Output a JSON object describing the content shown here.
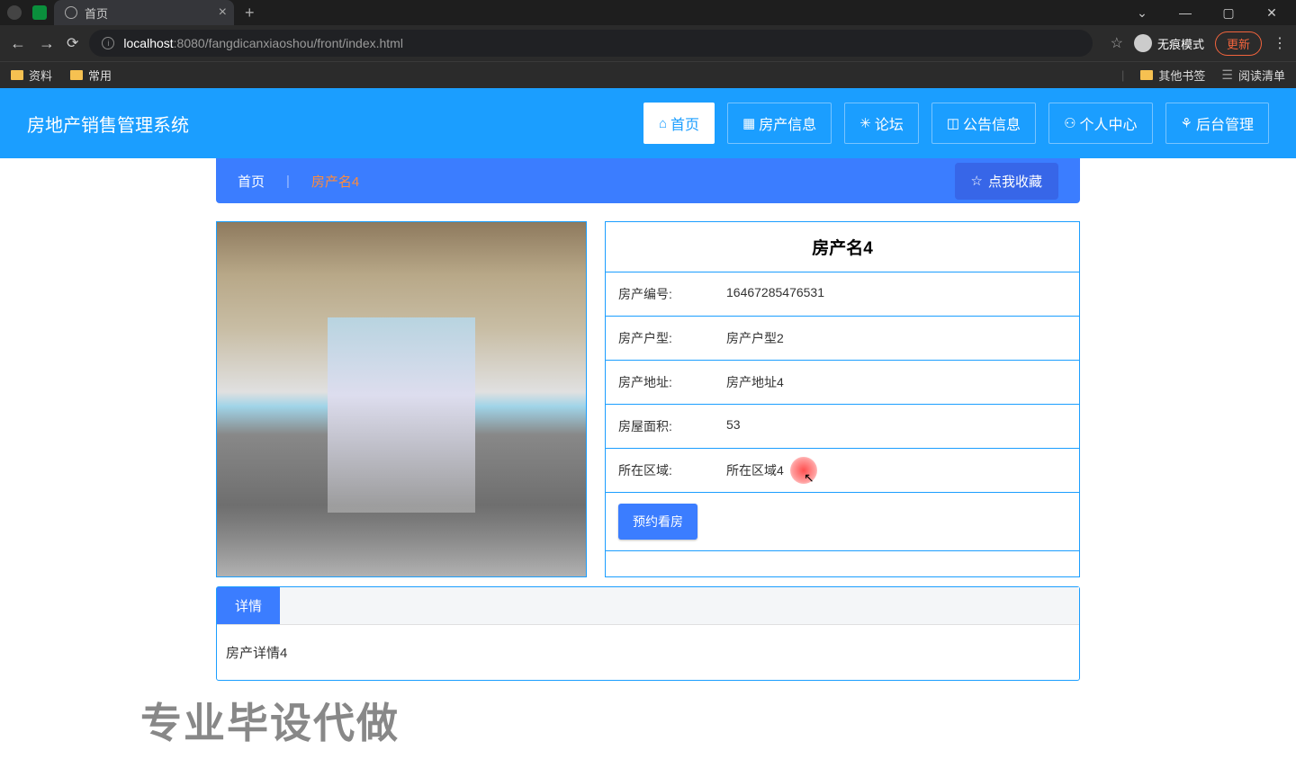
{
  "browser": {
    "tab_title": "首页",
    "url_host": "localhost",
    "url_port_path": ":8080/fangdicanxiaoshou/front/index.html",
    "incognito_label": "无痕模式",
    "update_label": "更新",
    "bookmarks": {
      "b1": "资料",
      "b2": "常用",
      "other": "其他书签",
      "readlist": "阅读清单"
    }
  },
  "header": {
    "logo": "房地产销售管理系统",
    "nav": {
      "home": "首页",
      "property": "房产信息",
      "forum": "论坛",
      "notice": "公告信息",
      "profile": "个人中心",
      "admin": "后台管理"
    }
  },
  "breadcrumb": {
    "home": "首页",
    "current": "房产名4",
    "favorite": "点我收藏"
  },
  "property": {
    "title": "房产名4",
    "code_label": "房产编号:",
    "code_value": "16467285476531",
    "type_label": "房产户型:",
    "type_value": "房产户型2",
    "addr_label": "房产地址:",
    "addr_value": "房产地址4",
    "area_label": "房屋面积:",
    "area_value": "53",
    "region_label": "所在区域:",
    "region_value": "所在区域4",
    "reserve_btn": "预约看房"
  },
  "tabs": {
    "detail_tab": "详情",
    "detail_content": "房产详情4"
  },
  "watermark": "专业毕设代做"
}
